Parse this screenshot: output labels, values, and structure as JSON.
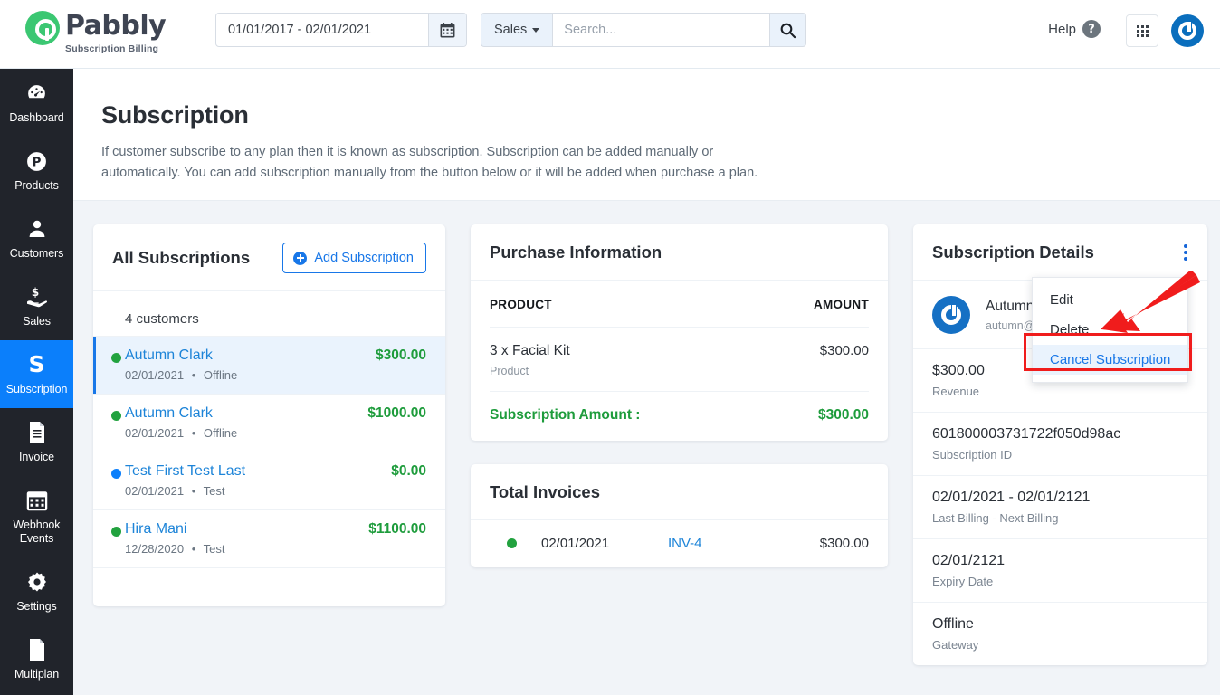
{
  "brand": {
    "name": "Pabbly",
    "tagline": "Subscription Billing"
  },
  "topbar": {
    "date_range": "01/01/2017 - 02/01/2021",
    "calendar_icon": "calendar-icon",
    "search_scope": "Sales",
    "search_placeholder": "Search...",
    "search_icon": "search-icon",
    "help_label": "Help",
    "help_icon": "question-mark-icon",
    "apps_icon": "grid-apps-icon",
    "avatar_icon": "user-power-icon"
  },
  "sidebar": {
    "items": [
      {
        "label": "Dashboard",
        "icon": "speedometer-icon",
        "active": false
      },
      {
        "label": "Products",
        "icon": "p-circle-icon",
        "active": false
      },
      {
        "label": "Customers",
        "icon": "person-icon",
        "active": false
      },
      {
        "label": "Sales",
        "icon": "hand-dollar-icon",
        "active": false
      },
      {
        "label": "Subscription",
        "icon": "letter-s-icon",
        "active": true
      },
      {
        "label": "Invoice",
        "icon": "document-lines-icon",
        "active": false
      },
      {
        "label": "Webhook Events",
        "icon": "calendar-icon",
        "active": false
      },
      {
        "label": "Settings",
        "icon": "gear-icon",
        "active": false
      },
      {
        "label": "Multiplan",
        "icon": "page-icon",
        "active": false
      }
    ]
  },
  "page": {
    "title": "Subscription",
    "description": "If customer subscribe to any plan then it is known as subscription. Subscription can be added manually or automatically. You can add subscription manually from the button below or it will be added when purchase a plan."
  },
  "all_subscriptions": {
    "title": "All Subscriptions",
    "add_button": "Add Subscription",
    "count_label": "4 customers",
    "rows": [
      {
        "name": "Autumn Clark",
        "amount": "$300.00",
        "date": "02/01/2021",
        "method": "Offline",
        "status_color": "green",
        "selected": true
      },
      {
        "name": "Autumn Clark",
        "amount": "$1000.00",
        "date": "02/01/2021",
        "method": "Offline",
        "status_color": "green",
        "selected": false
      },
      {
        "name": "Test First Test Last",
        "amount": "$0.00",
        "date": "02/01/2021",
        "method": "Test",
        "status_color": "blue",
        "selected": false
      },
      {
        "name": "Hira Mani",
        "amount": "$1100.00",
        "date": "12/28/2020",
        "method": "Test",
        "status_color": "green",
        "selected": false
      }
    ]
  },
  "purchase_information": {
    "title": "Purchase Information",
    "col_product": "PRODUCT",
    "col_amount": "AMOUNT",
    "rows": [
      {
        "name": "3 x Facial Kit",
        "type": "Product",
        "amount": "$300.00"
      }
    ],
    "total_label": "Subscription Amount :",
    "total_amount": "$300.00"
  },
  "total_invoices": {
    "title": "Total Invoices",
    "rows": [
      {
        "date": "02/01/2021",
        "invoice": "INV-4",
        "amount": "$300.00",
        "status_color": "green"
      }
    ]
  },
  "subscription_details": {
    "title": "Subscription Details",
    "kebab_icon": "kebab-menu-icon",
    "customer_name": "Autumn Clark",
    "customer_email": "autumn@example.com",
    "items": [
      {
        "value": "$300.00",
        "label": "Revenue"
      },
      {
        "value": "601800003731722f050d98ac",
        "label": "Subscription ID"
      },
      {
        "value": "02/01/2021 - 02/01/2121",
        "label": "Last Billing - Next Billing"
      },
      {
        "value": "02/01/2121",
        "label": "Expiry Date"
      },
      {
        "value": "Offline",
        "label": "Gateway"
      }
    ]
  },
  "dropdown": {
    "items": [
      {
        "label": "Edit",
        "highlight": false
      },
      {
        "label": "Delete",
        "highlight": false
      },
      {
        "label": "Cancel Subscription",
        "highlight": true
      }
    ]
  },
  "annotation": {
    "arrow_icon": "red-arrow-icon",
    "highlight_color": "#f01c1c"
  },
  "colors": {
    "sidebar_bg": "#21242b",
    "active_nav": "#0b7ffb",
    "link_blue": "#1d84d8",
    "money_green": "#1e9c3c",
    "brand_green": "#3bc772",
    "page_bg": "#f1f4f8"
  }
}
